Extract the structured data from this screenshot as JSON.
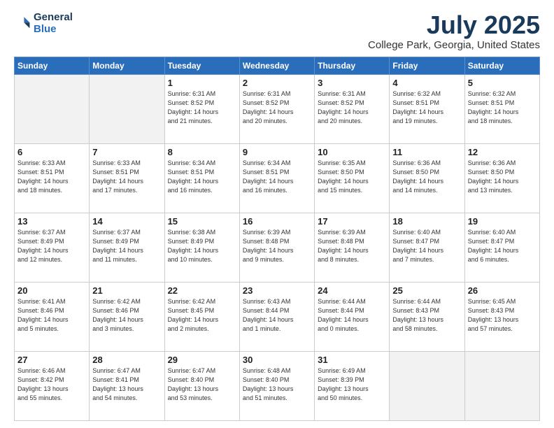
{
  "header": {
    "logo_line1": "General",
    "logo_line2": "Blue",
    "title": "July 2025",
    "subtitle": "College Park, Georgia, United States"
  },
  "days_of_week": [
    "Sunday",
    "Monday",
    "Tuesday",
    "Wednesday",
    "Thursday",
    "Friday",
    "Saturday"
  ],
  "weeks": [
    [
      {
        "day": "",
        "info": ""
      },
      {
        "day": "",
        "info": ""
      },
      {
        "day": "1",
        "info": "Sunrise: 6:31 AM\nSunset: 8:52 PM\nDaylight: 14 hours\nand 21 minutes."
      },
      {
        "day": "2",
        "info": "Sunrise: 6:31 AM\nSunset: 8:52 PM\nDaylight: 14 hours\nand 20 minutes."
      },
      {
        "day": "3",
        "info": "Sunrise: 6:31 AM\nSunset: 8:52 PM\nDaylight: 14 hours\nand 20 minutes."
      },
      {
        "day": "4",
        "info": "Sunrise: 6:32 AM\nSunset: 8:51 PM\nDaylight: 14 hours\nand 19 minutes."
      },
      {
        "day": "5",
        "info": "Sunrise: 6:32 AM\nSunset: 8:51 PM\nDaylight: 14 hours\nand 18 minutes."
      }
    ],
    [
      {
        "day": "6",
        "info": "Sunrise: 6:33 AM\nSunset: 8:51 PM\nDaylight: 14 hours\nand 18 minutes."
      },
      {
        "day": "7",
        "info": "Sunrise: 6:33 AM\nSunset: 8:51 PM\nDaylight: 14 hours\nand 17 minutes."
      },
      {
        "day": "8",
        "info": "Sunrise: 6:34 AM\nSunset: 8:51 PM\nDaylight: 14 hours\nand 16 minutes."
      },
      {
        "day": "9",
        "info": "Sunrise: 6:34 AM\nSunset: 8:51 PM\nDaylight: 14 hours\nand 16 minutes."
      },
      {
        "day": "10",
        "info": "Sunrise: 6:35 AM\nSunset: 8:50 PM\nDaylight: 14 hours\nand 15 minutes."
      },
      {
        "day": "11",
        "info": "Sunrise: 6:36 AM\nSunset: 8:50 PM\nDaylight: 14 hours\nand 14 minutes."
      },
      {
        "day": "12",
        "info": "Sunrise: 6:36 AM\nSunset: 8:50 PM\nDaylight: 14 hours\nand 13 minutes."
      }
    ],
    [
      {
        "day": "13",
        "info": "Sunrise: 6:37 AM\nSunset: 8:49 PM\nDaylight: 14 hours\nand 12 minutes."
      },
      {
        "day": "14",
        "info": "Sunrise: 6:37 AM\nSunset: 8:49 PM\nDaylight: 14 hours\nand 11 minutes."
      },
      {
        "day": "15",
        "info": "Sunrise: 6:38 AM\nSunset: 8:49 PM\nDaylight: 14 hours\nand 10 minutes."
      },
      {
        "day": "16",
        "info": "Sunrise: 6:39 AM\nSunset: 8:48 PM\nDaylight: 14 hours\nand 9 minutes."
      },
      {
        "day": "17",
        "info": "Sunrise: 6:39 AM\nSunset: 8:48 PM\nDaylight: 14 hours\nand 8 minutes."
      },
      {
        "day": "18",
        "info": "Sunrise: 6:40 AM\nSunset: 8:47 PM\nDaylight: 14 hours\nand 7 minutes."
      },
      {
        "day": "19",
        "info": "Sunrise: 6:40 AM\nSunset: 8:47 PM\nDaylight: 14 hours\nand 6 minutes."
      }
    ],
    [
      {
        "day": "20",
        "info": "Sunrise: 6:41 AM\nSunset: 8:46 PM\nDaylight: 14 hours\nand 5 minutes."
      },
      {
        "day": "21",
        "info": "Sunrise: 6:42 AM\nSunset: 8:46 PM\nDaylight: 14 hours\nand 3 minutes."
      },
      {
        "day": "22",
        "info": "Sunrise: 6:42 AM\nSunset: 8:45 PM\nDaylight: 14 hours\nand 2 minutes."
      },
      {
        "day": "23",
        "info": "Sunrise: 6:43 AM\nSunset: 8:44 PM\nDaylight: 14 hours\nand 1 minute."
      },
      {
        "day": "24",
        "info": "Sunrise: 6:44 AM\nSunset: 8:44 PM\nDaylight: 14 hours\nand 0 minutes."
      },
      {
        "day": "25",
        "info": "Sunrise: 6:44 AM\nSunset: 8:43 PM\nDaylight: 13 hours\nand 58 minutes."
      },
      {
        "day": "26",
        "info": "Sunrise: 6:45 AM\nSunset: 8:43 PM\nDaylight: 13 hours\nand 57 minutes."
      }
    ],
    [
      {
        "day": "27",
        "info": "Sunrise: 6:46 AM\nSunset: 8:42 PM\nDaylight: 13 hours\nand 55 minutes."
      },
      {
        "day": "28",
        "info": "Sunrise: 6:47 AM\nSunset: 8:41 PM\nDaylight: 13 hours\nand 54 minutes."
      },
      {
        "day": "29",
        "info": "Sunrise: 6:47 AM\nSunset: 8:40 PM\nDaylight: 13 hours\nand 53 minutes."
      },
      {
        "day": "30",
        "info": "Sunrise: 6:48 AM\nSunset: 8:40 PM\nDaylight: 13 hours\nand 51 minutes."
      },
      {
        "day": "31",
        "info": "Sunrise: 6:49 AM\nSunset: 8:39 PM\nDaylight: 13 hours\nand 50 minutes."
      },
      {
        "day": "",
        "info": ""
      },
      {
        "day": "",
        "info": ""
      }
    ]
  ]
}
